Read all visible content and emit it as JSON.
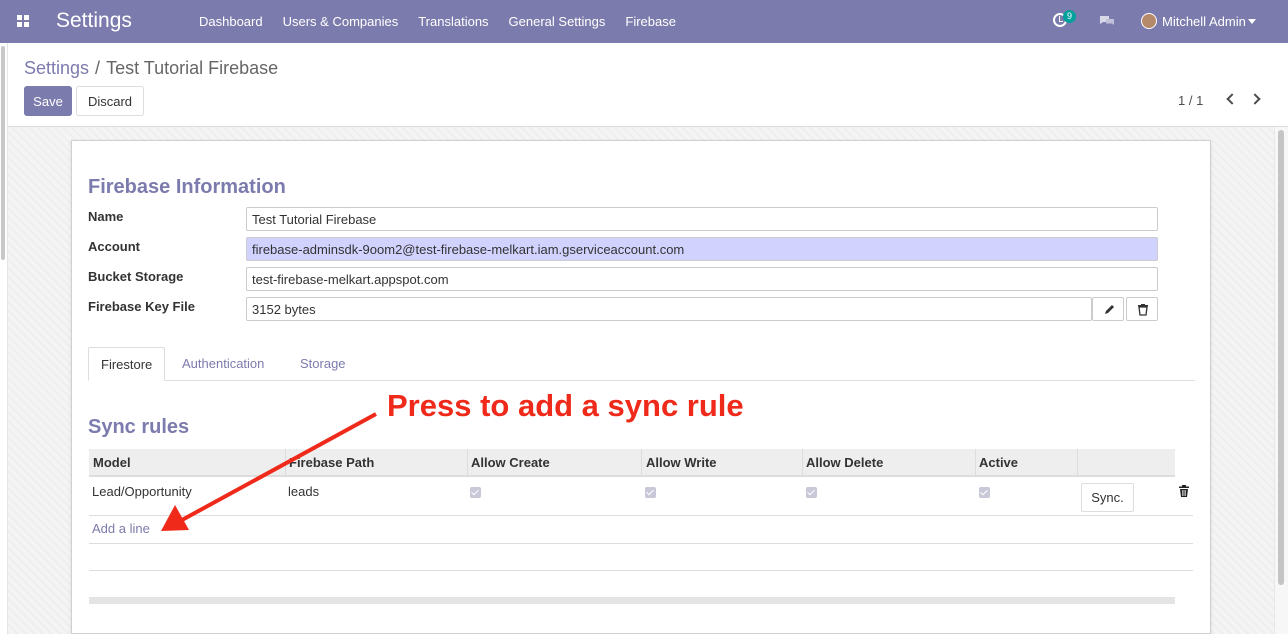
{
  "navbar": {
    "app_title": "Settings",
    "menu": [
      "Dashboard",
      "Users & Companies",
      "Translations",
      "General Settings",
      "Firebase"
    ],
    "activity_count": "9",
    "user_name": "Mitchell Admin"
  },
  "breadcrumb": {
    "parent": "Settings",
    "separator": "/",
    "current": "Test Tutorial Firebase"
  },
  "buttons": {
    "save": "Save",
    "discard": "Discard"
  },
  "pager": {
    "value": "1 / 1"
  },
  "form": {
    "section_title": "Firebase Information",
    "fields": {
      "name_label": "Name",
      "name_value": "Test Tutorial Firebase",
      "account_label": "Account",
      "account_value": "firebase-adminsdk-9oom2@test-firebase-melkart.iam.gserviceaccount.com",
      "bucket_label": "Bucket Storage",
      "bucket_value": "test-firebase-melkart.appspot.com",
      "key_label": "Firebase Key File",
      "key_value": "3152 bytes"
    }
  },
  "tabs": [
    "Firestore",
    "Authentication",
    "Storage"
  ],
  "annotation": "Press to add a sync rule",
  "sync": {
    "title": "Sync rules",
    "columns": [
      "Model",
      "Firebase Path",
      "Allow Create",
      "Allow Write",
      "Allow Delete",
      "Active"
    ],
    "rows": [
      {
        "model": "Lead/Opportunity",
        "path": "leads",
        "allow_create": true,
        "allow_write": true,
        "allow_delete": true,
        "active": true,
        "button": "Sync."
      }
    ],
    "add_line": "Add a line"
  },
  "colors": {
    "brand": "#7c7bad",
    "annotation": "#ef2a1a",
    "highlight_field": "#d2d2ff"
  }
}
